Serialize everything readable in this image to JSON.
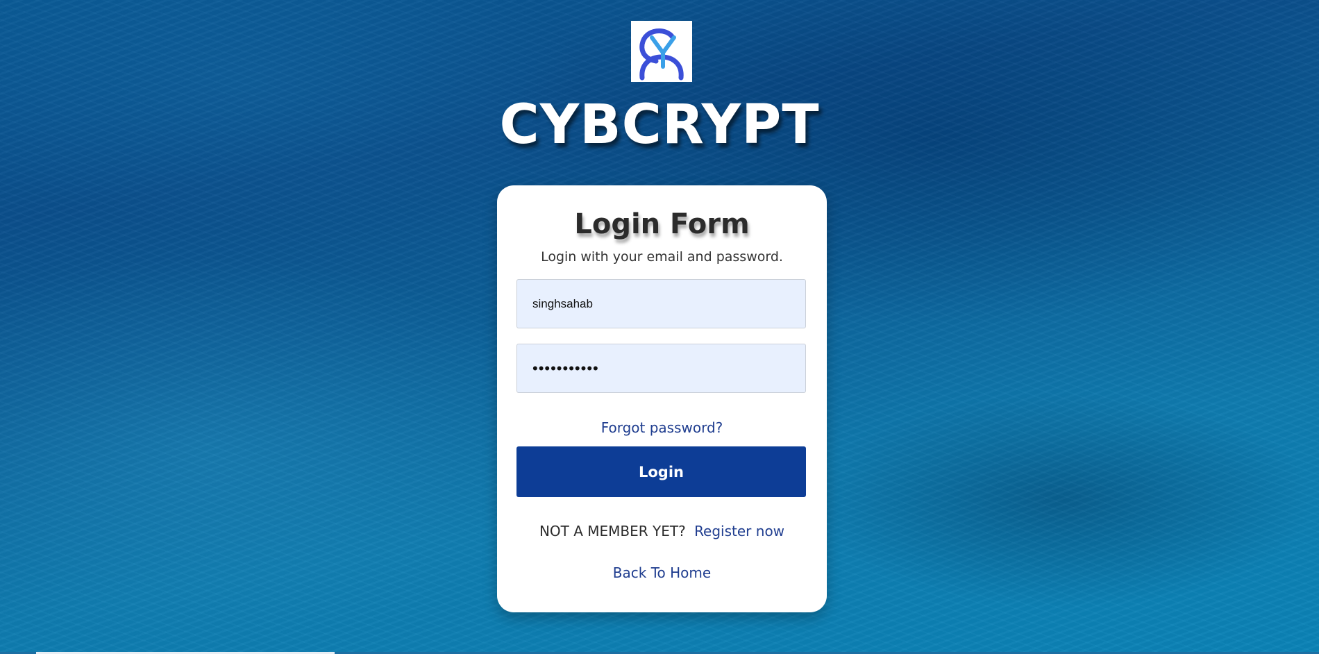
{
  "brand": {
    "logo_icon": "cy-monogram-logo-icon",
    "title": "CYBCRYPT"
  },
  "login_form": {
    "title": "Login Form",
    "subtitle": "Login with your email and password.",
    "username_value": "singhsahab",
    "password_value": "•••••••••••",
    "forgot_password": "Forgot password?",
    "login_button": "Login",
    "not_member": "NOT A MEMBER YET?",
    "register_link": "Register now",
    "back_home": "Back To Home"
  },
  "colors": {
    "primary": "#0d3d96",
    "link": "#1f3d8f",
    "input_background": "#e8f0fe",
    "logo_blue": "#3b4fd8"
  }
}
